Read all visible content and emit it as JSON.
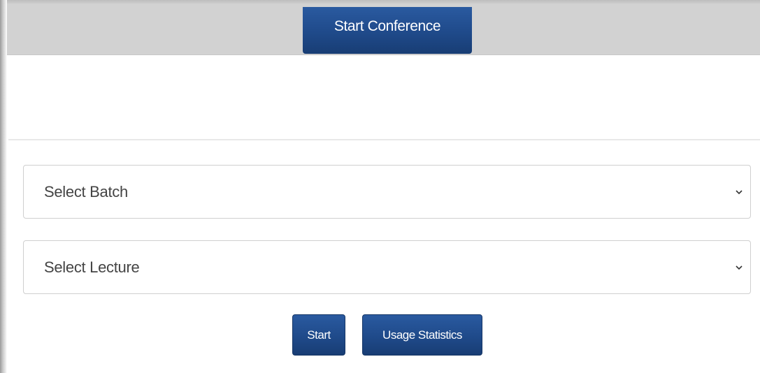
{
  "header": {
    "tab_label": "Start Conference"
  },
  "form": {
    "batch_select": {
      "selected": "Select Batch"
    },
    "lecture_select": {
      "selected": "Select Lecture"
    }
  },
  "actions": {
    "start_label": "Start",
    "usage_label": "Usage Statistics"
  },
  "colors": {
    "primary_button": "#1f4a8a",
    "header_bar": "#d2d2d2",
    "select_border": "#cfcfcf"
  },
  "icons": {
    "dropdown": "chevron-down-icon"
  }
}
